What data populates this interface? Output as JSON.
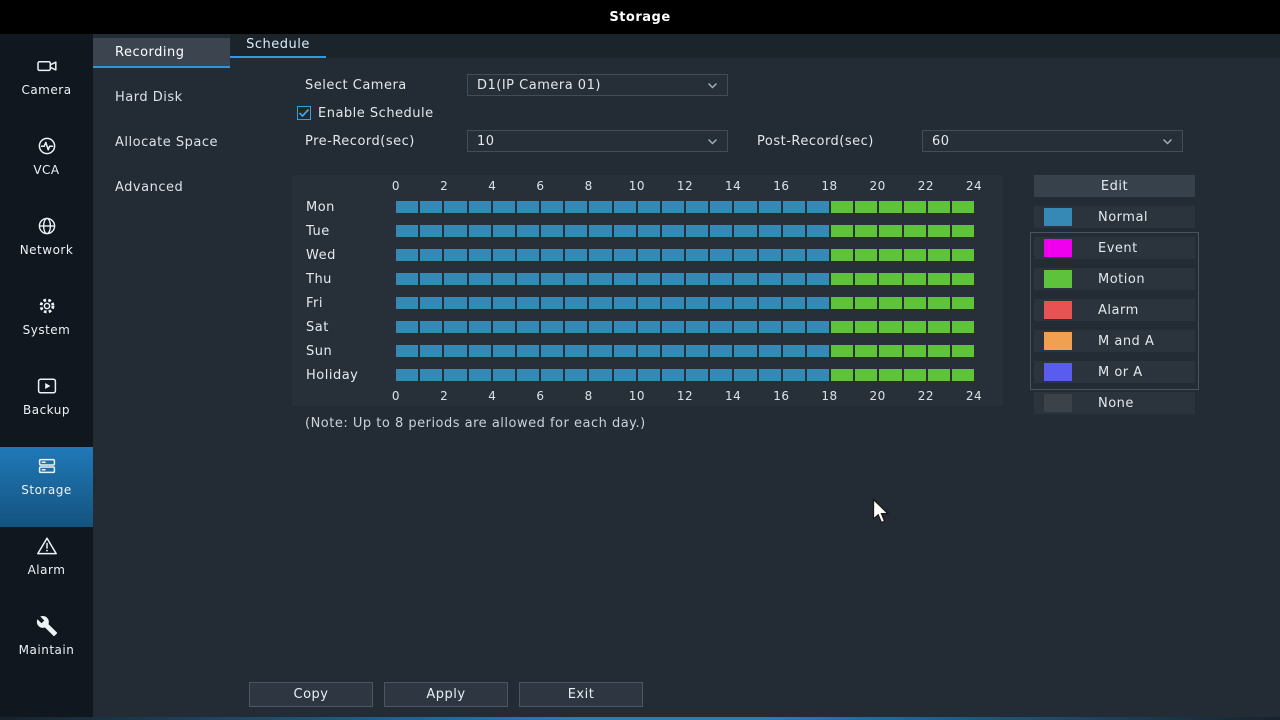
{
  "titlebar": {
    "title": "Storage"
  },
  "sidebar": {
    "items": [
      {
        "label": "Camera",
        "icon": "camera-icon",
        "selected": false
      },
      {
        "label": "VCA",
        "icon": "vca-icon",
        "selected": false
      },
      {
        "label": "Network",
        "icon": "network-icon",
        "selected": false
      },
      {
        "label": "System",
        "icon": "system-icon",
        "selected": false
      },
      {
        "label": "Backup",
        "icon": "backup-icon",
        "selected": false
      },
      {
        "label": "Storage",
        "icon": "storage-icon",
        "selected": true
      },
      {
        "label": "Alarm",
        "icon": "alarm-icon",
        "selected": false
      },
      {
        "label": "Maintain",
        "icon": "maintain-icon",
        "selected": false
      }
    ]
  },
  "submenu": {
    "items": [
      {
        "label": "Recording",
        "selected": true
      },
      {
        "label": "Hard Disk",
        "selected": false
      },
      {
        "label": "Allocate Space",
        "selected": false
      },
      {
        "label": "Advanced",
        "selected": false
      }
    ]
  },
  "tabs": [
    {
      "label": "Schedule",
      "active": true
    }
  ],
  "form": {
    "select_camera_label": "Select Camera",
    "select_camera_value": "D1(IP Camera 01)",
    "enable_schedule_label": "Enable Schedule",
    "enable_schedule_checked": true,
    "pre_record_label": "Pre-Record(sec)",
    "pre_record_value": "10",
    "post_record_label": "Post-Record(sec)",
    "post_record_value": "60"
  },
  "schedule": {
    "days": [
      "Mon",
      "Tue",
      "Wed",
      "Thu",
      "Fri",
      "Sat",
      "Sun",
      "Holiday"
    ],
    "time_ticks": [
      "0",
      "2",
      "4",
      "6",
      "8",
      "10",
      "12",
      "14",
      "16",
      "18",
      "20",
      "22",
      "24"
    ],
    "segments": [
      {
        "type": "Normal",
        "start": 0,
        "end": 18
      },
      {
        "type": "Motion",
        "start": 18,
        "end": 24
      }
    ],
    "note": "(Note: Up to 8 periods are allowed for each day.)"
  },
  "legend": {
    "edit_label": "Edit",
    "items": [
      {
        "label": "Normal",
        "color": "#3589b4"
      },
      {
        "label": "Event",
        "color": "#ee00ee"
      },
      {
        "label": "Motion",
        "color": "#5fc23c"
      },
      {
        "label": "Alarm",
        "color": "#e85252"
      },
      {
        "label": "M and A",
        "color": "#f0a04e"
      },
      {
        "label": "M or A",
        "color": "#5a5cf0"
      },
      {
        "label": "None",
        "color": "#3b4249"
      }
    ]
  },
  "footer_buttons": [
    {
      "label": "Copy"
    },
    {
      "label": "Apply"
    },
    {
      "label": "Exit"
    }
  ],
  "colors": {
    "accent_blue": "#2f9ae0",
    "panel_bg": "#272f38",
    "sidebar_selected": "#1c6fae"
  }
}
